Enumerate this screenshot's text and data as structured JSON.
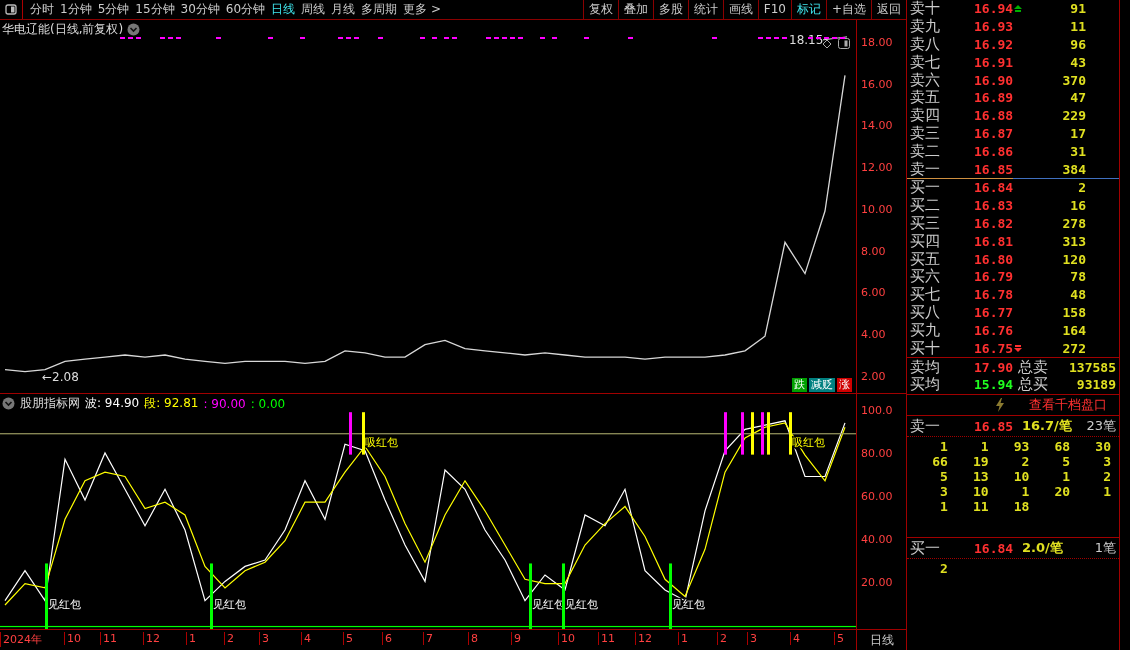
{
  "toolbar": {
    "period_tabs": [
      {
        "label": "分时",
        "selected": false
      },
      {
        "label": "1分钟",
        "selected": false
      },
      {
        "label": "5分钟",
        "selected": false
      },
      {
        "label": "15分钟",
        "selected": false
      },
      {
        "label": "30分钟",
        "selected": false
      },
      {
        "label": "60分钟",
        "selected": false
      },
      {
        "label": "日线",
        "selected": true
      },
      {
        "label": "周线",
        "selected": false
      },
      {
        "label": "月线",
        "selected": false
      },
      {
        "label": "多周期",
        "selected": false
      },
      {
        "label": "更多 >",
        "selected": false
      }
    ],
    "buttons": [
      {
        "label": "复权",
        "selected": false
      },
      {
        "label": "叠加",
        "selected": false
      },
      {
        "label": "多股",
        "selected": false
      },
      {
        "label": "统计",
        "selected": false
      },
      {
        "label": "画线",
        "selected": false
      },
      {
        "label": "F10",
        "selected": false
      },
      {
        "label": "标记",
        "selected": true
      },
      {
        "label": "+自选",
        "selected": false
      },
      {
        "label": "返回",
        "selected": false
      }
    ]
  },
  "price_chart": {
    "title": "华电辽能(日线,前复权)",
    "tags": [
      {
        "label": "跌",
        "color": "#00a000"
      },
      {
        "label": "减贬",
        "color": "#008080"
      },
      {
        "label": "涨",
        "color": "#d00000"
      }
    ],
    "chart_data": {
      "type": "line",
      "series": [
        {
          "color": "#d8d8d8",
          "values": [
            2.4,
            2.3,
            2.4,
            2.8,
            2.9,
            3.0,
            3.1,
            3.0,
            3.1,
            2.9,
            2.8,
            2.7,
            2.8,
            2.8,
            2.8,
            2.7,
            2.8,
            3.3,
            3.2,
            3.0,
            3.0,
            3.6,
            3.8,
            3.4,
            3.3,
            3.2,
            3.1,
            3.2,
            3.1,
            3.0,
            3.0,
            3.0,
            2.9,
            3.0,
            3.0,
            3.0,
            3.1,
            3.3,
            4.0,
            8.5,
            7.0,
            10.0,
            16.5
          ]
        }
      ],
      "ylim": [
        1.28,
        19.15
      ],
      "yticks": [
        {
          "value": 2,
          "label": "2.00"
        },
        {
          "value": 4,
          "label": "4.00"
        },
        {
          "value": 6,
          "label": "6.00"
        },
        {
          "value": 8,
          "label": "8.00"
        },
        {
          "value": 10,
          "label": "10.00"
        },
        {
          "value": 12,
          "label": "12.00"
        },
        {
          "value": 14,
          "label": "14.00"
        },
        {
          "value": 16,
          "label": "16.00"
        },
        {
          "value": 18,
          "label": "18.00"
        }
      ],
      "annotations": [
        "18.15",
        "←2.08"
      ]
    }
  },
  "indicator": {
    "name": "股朋指标网",
    "readings": [
      {
        "text": "波: 94.90",
        "color": "#ffffff"
      },
      {
        "text": "段: 92.81",
        "color": "#ffff00"
      },
      {
        "text": ": 90.00",
        "color": "#ff00ff"
      },
      {
        "text": ": 0.00",
        "color": "#00ff00"
      }
    ],
    "chart_data": {
      "type": "line",
      "series": [
        {
          "color": "#ffffff",
          "values": [
            12,
            26,
            12,
            78,
            59,
            81,
            64,
            47,
            64,
            45,
            12,
            21,
            28,
            31,
            45,
            68,
            50,
            85,
            82,
            59,
            38,
            21,
            73,
            64,
            45,
            31,
            12,
            24,
            17,
            52,
            47,
            64,
            26,
            17,
            12,
            54,
            82,
            92,
            94,
            96,
            70,
            70,
            95
          ]
        },
        {
          "color": "#ffff00",
          "values": [
            10,
            20,
            18,
            50,
            68,
            72,
            70,
            55,
            58,
            52,
            28,
            18,
            26,
            30,
            40,
            58,
            58,
            72,
            84,
            70,
            48,
            30,
            52,
            68,
            54,
            38,
            22,
            20,
            20,
            38,
            48,
            56,
            42,
            22,
            14,
            36,
            72,
            88,
            93,
            95,
            80,
            68,
            93
          ]
        }
      ],
      "ylim": [
        -1.2,
        108.5
      ],
      "yticks": [
        {
          "value": 20,
          "label": "20.00"
        },
        {
          "value": 40,
          "label": "40.00"
        },
        {
          "value": 60,
          "label": "60.00"
        },
        {
          "value": 80,
          "label": "80.00"
        },
        {
          "value": 100,
          "label": "100.0"
        }
      ],
      "annotations": [
        "见红包",
        "见红包",
        "见红包",
        "见红包",
        "见红包",
        "吸红包",
        "吸红包"
      ]
    }
  },
  "time_axis": {
    "labels": [
      "2024年",
      "10",
      "11",
      "12",
      "1",
      "2",
      "3",
      "4",
      "5",
      "6",
      "7",
      "8",
      "9",
      "10",
      "11",
      "12",
      "1",
      "2",
      "3",
      "4",
      "5"
    ],
    "period": "日线"
  },
  "order_book": {
    "asks": [
      {
        "kind": "up",
        "label": "卖十",
        "price": "16.94",
        "volume": "91"
      },
      {
        "kind": "plain",
        "label": "卖九",
        "price": "16.93",
        "volume": "11"
      },
      {
        "kind": "plain",
        "label": "卖八",
        "price": "16.92",
        "volume": "96"
      },
      {
        "kind": "plain",
        "label": "卖七",
        "price": "16.91",
        "volume": "43"
      },
      {
        "kind": "plain",
        "label": "卖六",
        "price": "16.90",
        "volume": "370"
      },
      {
        "kind": "plain",
        "label": "卖五",
        "price": "16.89",
        "volume": "47"
      },
      {
        "kind": "plain",
        "label": "卖四",
        "price": "16.88",
        "volume": "229"
      },
      {
        "kind": "plain",
        "label": "卖三",
        "price": "16.87",
        "volume": "17"
      },
      {
        "kind": "plain",
        "label": "卖二",
        "price": "16.86",
        "volume": "31"
      },
      {
        "kind": "plain",
        "label": "卖一",
        "price": "16.85",
        "volume": "384"
      }
    ],
    "bids": [
      {
        "kind": "plain",
        "label": "买一",
        "price": "16.84",
        "volume": "2"
      },
      {
        "kind": "plain",
        "label": "买二",
        "price": "16.83",
        "volume": "16"
      },
      {
        "kind": "plain",
        "label": "买三",
        "price": "16.82",
        "volume": "278"
      },
      {
        "kind": "plain",
        "label": "买四",
        "price": "16.81",
        "volume": "313"
      },
      {
        "kind": "plain",
        "label": "买五",
        "price": "16.80",
        "volume": "120"
      },
      {
        "kind": "plain",
        "label": "买六",
        "price": "16.79",
        "volume": "78"
      },
      {
        "kind": "plain",
        "label": "买七",
        "price": "16.78",
        "volume": "48"
      },
      {
        "kind": "plain",
        "label": "买八",
        "price": "16.77",
        "volume": "158"
      },
      {
        "kind": "plain",
        "label": "买九",
        "price": "16.76",
        "volume": "164"
      },
      {
        "kind": "down",
        "label": "买十",
        "price": "16.75",
        "volume": "272"
      }
    ],
    "summary": [
      {
        "label": "卖均",
        "price": "17.90",
        "color": "#ff3030",
        "total_label": "总卖",
        "total": "137585"
      },
      {
        "label": "买均",
        "price": "15.94",
        "color": "#20ff20",
        "total_label": "总买",
        "total": "93189"
      }
    ],
    "deep_link": "查看千档盘口",
    "queues": [
      {
        "label": "卖一",
        "price": "16.85",
        "average": "16.7/笔",
        "count": "23笔",
        "orders": [
          "1",
          "1",
          "93",
          "68",
          "30",
          "66",
          "19",
          "2",
          "5",
          "3",
          "5",
          "13",
          "10",
          "1",
          "2",
          "3",
          "10",
          "1",
          "20",
          "1",
          "1",
          "11",
          "18"
        ]
      },
      {
        "label": "买一",
        "price": "16.84",
        "average": "2.0/笔",
        "count": "1笔",
        "orders": [
          "2"
        ]
      }
    ]
  }
}
